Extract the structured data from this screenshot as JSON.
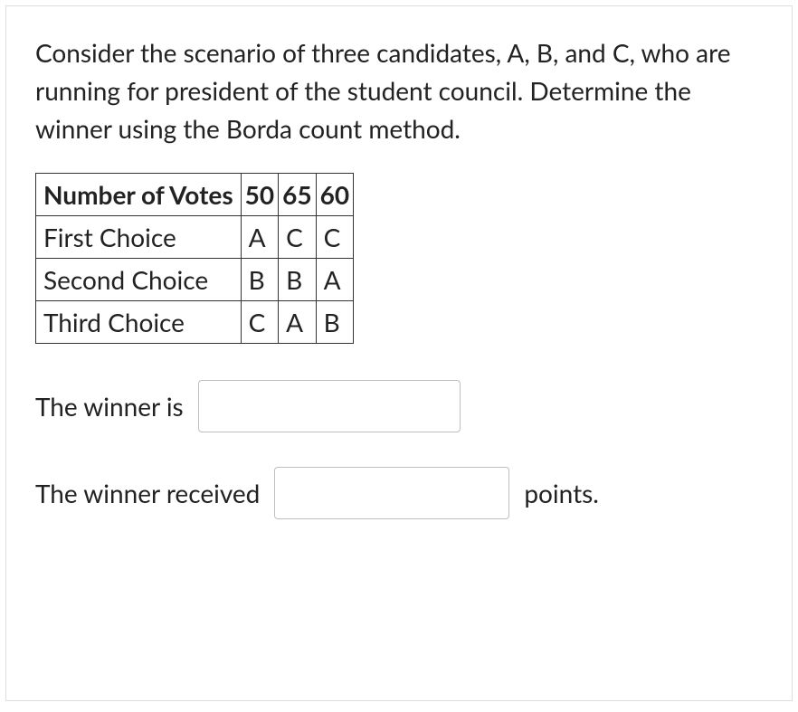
{
  "question": {
    "text": "Consider the scenario of three candidates, A, B, and C, who are running for president of the student council. Determine the winner using the Borda count method."
  },
  "table": {
    "header": {
      "label": "Number of Votes",
      "cols": [
        "50",
        "65",
        "60"
      ]
    },
    "rows": [
      {
        "label": "First Choice",
        "cols": [
          "A",
          "C",
          "C"
        ]
      },
      {
        "label": "Second Choice",
        "cols": [
          "B",
          "B",
          "A"
        ]
      },
      {
        "label": "Third Choice",
        "cols": [
          "C",
          "A",
          "B"
        ]
      }
    ]
  },
  "answers": {
    "winner_label": "The winner is",
    "winner_value": "",
    "points_label": "The winner received",
    "points_value": "",
    "points_after": "points."
  }
}
